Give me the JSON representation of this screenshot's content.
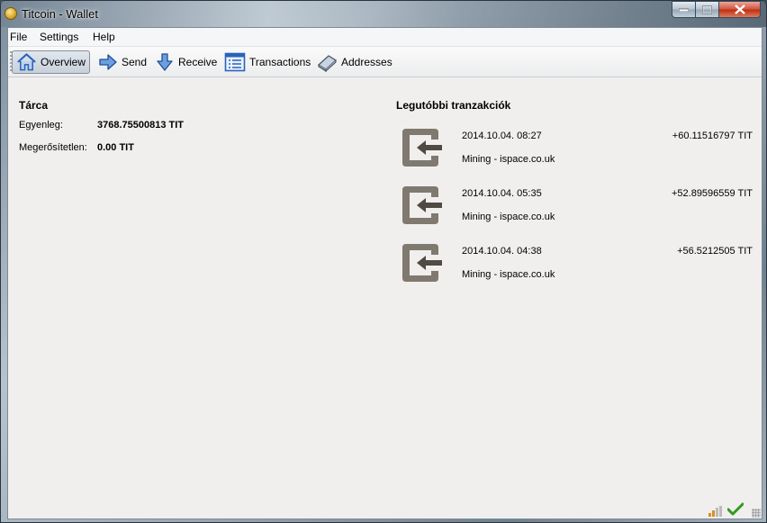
{
  "window": {
    "title": "Titcoin - Wallet"
  },
  "menu": {
    "items": [
      "File",
      "Settings",
      "Help"
    ]
  },
  "toolbar": {
    "overview": "Overview",
    "send": "Send",
    "receive": "Receive",
    "transactions": "Transactions",
    "addresses": "Addresses"
  },
  "wallet": {
    "title": "Tárca",
    "balance_label": "Egyenleg:",
    "balance_value": "3768.75500813 TIT",
    "unconfirmed_label": "Megerősítetlen:",
    "unconfirmed_value": "0.00 TIT"
  },
  "recent": {
    "title": "Legutóbbi tranzakciók",
    "transactions": [
      {
        "date": "2014.10.04. 08:27",
        "amount": "+60.11516797 TIT",
        "label": "Mining - ispace.co.uk"
      },
      {
        "date": "2014.10.04. 05:35",
        "amount": "+52.89596559 TIT",
        "label": "Mining - ispace.co.uk"
      },
      {
        "date": "2014.10.04. 04:38",
        "amount": "+56.5212505 TIT",
        "label": "Mining - ispace.co.uk"
      }
    ]
  },
  "colors": {
    "accent": "#2a63b8",
    "tx_icon": "#807970",
    "sync_ok": "#2f9a1e"
  }
}
